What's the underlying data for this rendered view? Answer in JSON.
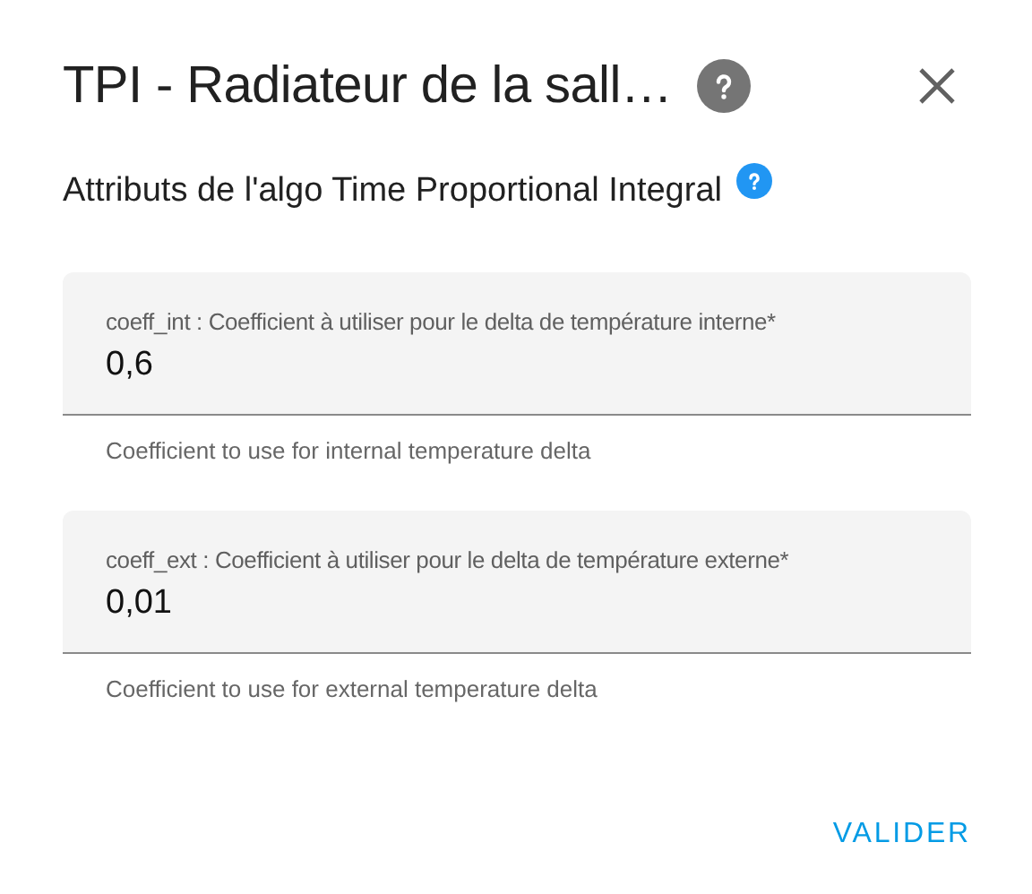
{
  "dialog": {
    "title": "TPI - Radiateur de la sall…",
    "subtitle": "Attributs de l'algo Time Proportional Integral"
  },
  "fields": [
    {
      "label": "coeff_int : Coefficient à utiliser pour le delta de température interne*",
      "value": "0,6",
      "helper": "Coefficient to use for internal temperature delta"
    },
    {
      "label": "coeff_ext : Coefficient à utiliser pour le delta de température externe*",
      "value": "0,01",
      "helper": "Coefficient to use for external temperature delta"
    }
  ],
  "actions": [
    "VALIDER"
  ]
}
